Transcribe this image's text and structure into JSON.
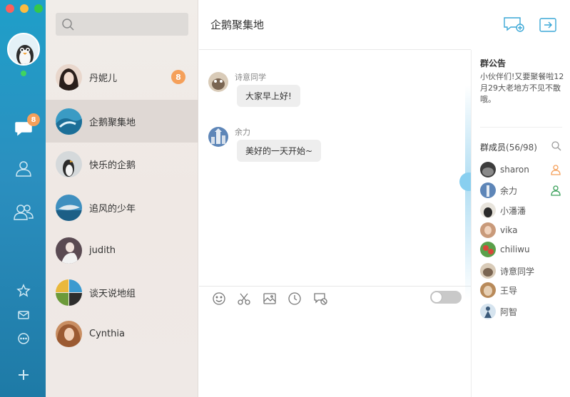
{
  "window": {
    "title": "企鹅聚集地"
  },
  "rail": {
    "chat_badge": "8",
    "icons": [
      "chat-bubble-icon",
      "contact-icon",
      "group-icon",
      "star-icon",
      "mail-icon",
      "more-icon",
      "plus-icon"
    ]
  },
  "search": {
    "placeholder": ""
  },
  "conversations": [
    {
      "name": "丹妮儿",
      "badge": "8"
    },
    {
      "name": "企鹅聚集地",
      "badge": ""
    },
    {
      "name": "快乐的企鹅",
      "badge": ""
    },
    {
      "name": "追风的少年",
      "badge": ""
    },
    {
      "name": "judith",
      "badge": ""
    },
    {
      "name": "谈天说地组",
      "badge": ""
    },
    {
      "name": "Cynthia",
      "badge": ""
    }
  ],
  "chat": {
    "title": "企鹅聚集地",
    "messages": [
      {
        "sender": "诗意同学",
        "text": "大家早上好!"
      },
      {
        "sender": "余力",
        "text": "美好的一天开始~"
      }
    ]
  },
  "side": {
    "notice_title": "群公告",
    "notice_text": "小伙伴们!又要聚餐啦12月29大老地方不见不散哦。",
    "members_title": "群成员",
    "members_count": "(56/98)",
    "members": [
      {
        "name": "sharon",
        "role": "admin"
      },
      {
        "name": "余力",
        "role": "admin"
      },
      {
        "name": "小潘潘",
        "role": ""
      },
      {
        "name": "vika",
        "role": ""
      },
      {
        "name": "chiliwu",
        "role": ""
      },
      {
        "name": "诗意同学",
        "role": ""
      },
      {
        "name": "王导",
        "role": ""
      },
      {
        "name": "阿智",
        "role": ""
      }
    ]
  },
  "colors": {
    "accent": "#3aa7d6",
    "badge": "#f5a05a",
    "rail": "#2b8fbf",
    "online": "#40d460",
    "admin_green": "#3aa05a",
    "admin_orange": "#f5a05a"
  }
}
